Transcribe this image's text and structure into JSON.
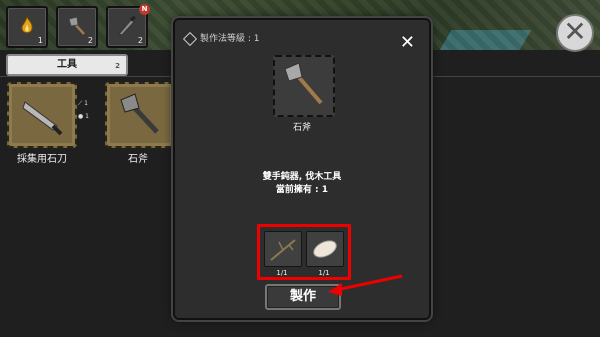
{
  "colors": {
    "highlight": "#ee0000",
    "card": "#7a6940",
    "modal": "#2d2d2d"
  },
  "toolbar": {
    "slots": [
      {
        "icon": "fire-icon",
        "count": "1"
      },
      {
        "icon": "axe-icon",
        "count": "2"
      },
      {
        "icon": "knife-icon",
        "count": "2",
        "badge": "N"
      }
    ],
    "close_icon": "close-icon"
  },
  "tab": {
    "label": "工具",
    "count": "2"
  },
  "recipes": [
    {
      "name": "採集用石刀",
      "icon": "stone-knife-icon",
      "ingredients": [
        "1",
        "1"
      ]
    },
    {
      "name": "石斧",
      "icon": "stone-axe-icon"
    }
  ],
  "modal": {
    "header": "製作法等級 : 1",
    "close_label": "✕",
    "item_name": "石斧",
    "description_line1": "雙手鈍器, 伐木工具",
    "description_line2": "當前擁有 : 1",
    "ingredients": [
      {
        "icon": "branch-icon",
        "count": "1/1"
      },
      {
        "icon": "stone-icon",
        "count": "1/1"
      }
    ],
    "craft_label": "製作"
  }
}
